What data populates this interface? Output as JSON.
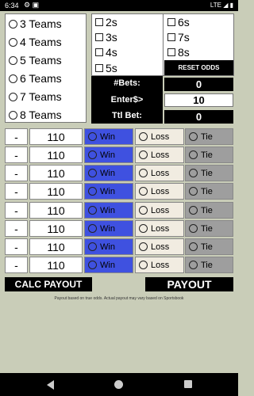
{
  "status": {
    "time": "6:34",
    "network": "LTE",
    "left_icons": "⚙ ▣",
    "right_icons": "LTE ◢ ▮"
  },
  "teams": [
    "3 Teams",
    "4 Teams",
    "5 Teams",
    "6 Teams",
    "7 Teams",
    "8 Teams"
  ],
  "teasers_left": [
    "2s",
    "3s",
    "4s",
    "5s"
  ],
  "teasers_right": [
    "6s",
    "7s",
    "8s"
  ],
  "reset_label": "RESET ODDS",
  "info": {
    "bets_label": "#Bets:",
    "enter_label": "Enter$>",
    "total_label": "Ttl Bet:"
  },
  "values": {
    "bets": "0",
    "enter": "10",
    "total": "0"
  },
  "rows": [
    {
      "dash": "-",
      "odds": "110",
      "win": "Win",
      "loss": "Loss",
      "tie": "Tie"
    },
    {
      "dash": "-",
      "odds": "110",
      "win": "Win",
      "loss": "Loss",
      "tie": "Tie"
    },
    {
      "dash": "-",
      "odds": "110",
      "win": "Win",
      "loss": "Loss",
      "tie": "Tie"
    },
    {
      "dash": "-",
      "odds": "110",
      "win": "Win",
      "loss": "Loss",
      "tie": "Tie"
    },
    {
      "dash": "-",
      "odds": "110",
      "win": "Win",
      "loss": "Loss",
      "tie": "Tie"
    },
    {
      "dash": "-",
      "odds": "110",
      "win": "Win",
      "loss": "Loss",
      "tie": "Tie"
    },
    {
      "dash": "-",
      "odds": "110",
      "win": "Win",
      "loss": "Loss",
      "tie": "Tie"
    },
    {
      "dash": "-",
      "odds": "110",
      "win": "Win",
      "loss": "Loss",
      "tie": "Tie"
    }
  ],
  "buttons": {
    "calc": "CALC PAYOUT",
    "payout": "PAYOUT"
  },
  "note": "Payout based on true odds. Actual payout may vary based on Sportsbook",
  "colors": {
    "win": "#3f51e0",
    "loss": "#f1ece1",
    "tie": "#9e9e9e",
    "background": "#c9cdb8"
  }
}
